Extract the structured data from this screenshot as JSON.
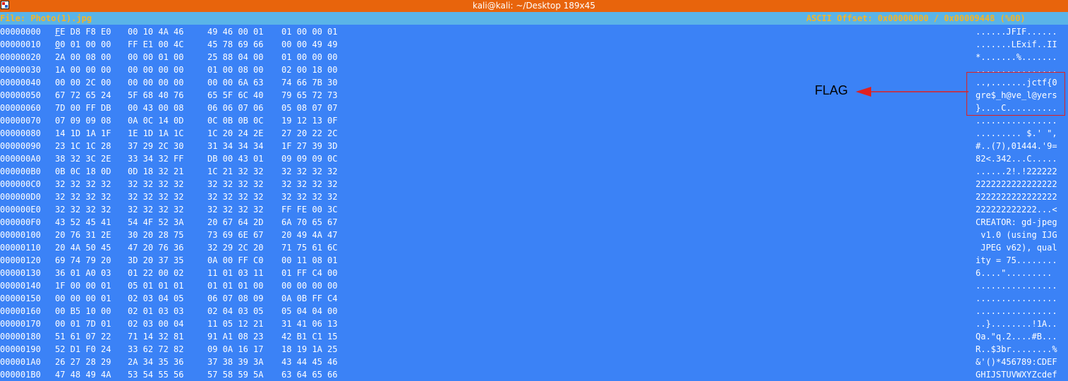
{
  "window": {
    "title": "kali@kali: ~/Desktop 189x45"
  },
  "status": {
    "file": "File: Photo(1).jpg",
    "offset": "ASCII Offset: 0x00000000 / 0x00009448 (%00)"
  },
  "rows": [
    {
      "offset": "00000000",
      "hex": [
        "FE D8 F8 E0",
        "00 10 4A 46",
        "49 46 00 01",
        "01 00 00 01"
      ],
      "ascii": "......JFIF......"
    },
    {
      "offset": "00000010",
      "hex": [
        "00 01 00 00",
        "FF E1 00 4C",
        "45 78 69 66",
        "00 00 49 49"
      ],
      "ascii": ".......LExif..II"
    },
    {
      "offset": "00000020",
      "hex": [
        "2A 00 08 00",
        "00 00 01 00",
        "25 88 04 00",
        "01 00 00 00"
      ],
      "ascii": "*.......%......."
    },
    {
      "offset": "00000030",
      "hex": [
        "1A 00 00 00",
        "00 00 00 00",
        "01 00 08 00",
        "02 00 18 00"
      ],
      "ascii": "................"
    },
    {
      "offset": "00000040",
      "hex": [
        "00 00 2C 00",
        "00 00 00 00",
        "00 00 6A 63",
        "74 66 7B 30"
      ],
      "ascii": "..,.......jctf{0"
    },
    {
      "offset": "00000050",
      "hex": [
        "67 72 65 24",
        "5F 68 40 76",
        "65 5F 6C 40",
        "79 65 72 73"
      ],
      "ascii": "gre$_h@ve_l@yers"
    },
    {
      "offset": "00000060",
      "hex": [
        "7D 00 FF DB",
        "00 43 00 08",
        "06 06 07 06",
        "05 08 07 07"
      ],
      "ascii": "}....C.........."
    },
    {
      "offset": "00000070",
      "hex": [
        "07 09 09 08",
        "0A 0C 14 0D",
        "0C 0B 0B 0C",
        "19 12 13 0F"
      ],
      "ascii": "................"
    },
    {
      "offset": "00000080",
      "hex": [
        "14 1D 1A 1F",
        "1E 1D 1A 1C",
        "1C 20 24 2E",
        "27 20 22 2C"
      ],
      "ascii": "......... $.' \","
    },
    {
      "offset": "00000090",
      "hex": [
        "23 1C 1C 28",
        "37 29 2C 30",
        "31 34 34 34",
        "1F 27 39 3D"
      ],
      "ascii": "#..(7),01444.'9="
    },
    {
      "offset": "000000A0",
      "hex": [
        "38 32 3C 2E",
        "33 34 32 FF",
        "DB 00 43 01",
        "09 09 09 0C"
      ],
      "ascii": "82<.342...C....."
    },
    {
      "offset": "000000B0",
      "hex": [
        "0B 0C 18 0D",
        "0D 18 32 21",
        "1C 21 32 32",
        "32 32 32 32"
      ],
      "ascii": "......2!.!222222"
    },
    {
      "offset": "000000C0",
      "hex": [
        "32 32 32 32",
        "32 32 32 32",
        "32 32 32 32",
        "32 32 32 32"
      ],
      "ascii": "2222222222222222"
    },
    {
      "offset": "000000D0",
      "hex": [
        "32 32 32 32",
        "32 32 32 32",
        "32 32 32 32",
        "32 32 32 32"
      ],
      "ascii": "2222222222222222"
    },
    {
      "offset": "000000E0",
      "hex": [
        "32 32 32 32",
        "32 32 32 32",
        "32 32 32 32",
        "FF FE 00 3C"
      ],
      "ascii": "222222222222...<"
    },
    {
      "offset": "000000F0",
      "hex": [
        "43 52 45 41",
        "54 4F 52 3A",
        "20 67 64 2D",
        "6A 70 65 67"
      ],
      "ascii": "CREATOR: gd-jpeg"
    },
    {
      "offset": "00000100",
      "hex": [
        "20 76 31 2E",
        "30 20 28 75",
        "73 69 6E 67",
        "20 49 4A 47"
      ],
      "ascii": " v1.0 (using IJG"
    },
    {
      "offset": "00000110",
      "hex": [
        "20 4A 50 45",
        "47 20 76 36",
        "32 29 2C 20",
        "71 75 61 6C"
      ],
      "ascii": " JPEG v62), qual"
    },
    {
      "offset": "00000120",
      "hex": [
        "69 74 79 20",
        "3D 20 37 35",
        "0A 00 FF C0",
        "00 11 08 01"
      ],
      "ascii": "ity = 75........"
    },
    {
      "offset": "00000130",
      "hex": [
        "36 01 A0 03",
        "01 22 00 02",
        "11 01 03 11",
        "01 FF C4 00"
      ],
      "ascii": "6....\"........."
    },
    {
      "offset": "00000140",
      "hex": [
        "1F 00 00 01",
        "05 01 01 01",
        "01 01 01 00",
        "00 00 00 00"
      ],
      "ascii": "................"
    },
    {
      "offset": "00000150",
      "hex": [
        "00 00 00 01",
        "02 03 04 05",
        "06 07 08 09",
        "0A 0B FF C4"
      ],
      "ascii": "................"
    },
    {
      "offset": "00000160",
      "hex": [
        "00 B5 10 00",
        "02 01 03 03",
        "02 04 03 05",
        "05 04 04 00"
      ],
      "ascii": "................"
    },
    {
      "offset": "00000170",
      "hex": [
        "00 01 7D 01",
        "02 03 00 04",
        "11 05 12 21",
        "31 41 06 13"
      ],
      "ascii": "..}........!1A.."
    },
    {
      "offset": "00000180",
      "hex": [
        "51 61 07 22",
        "71 14 32 81",
        "91 A1 08 23",
        "42 B1 C1 15"
      ],
      "ascii": "Qa.\"q.2....#B..."
    },
    {
      "offset": "00000190",
      "hex": [
        "52 D1 F0 24",
        "33 62 72 82",
        "09 0A 16 17",
        "18 19 1A 25"
      ],
      "ascii": "R..$3br........%"
    },
    {
      "offset": "000001A0",
      "hex": [
        "26 27 28 29",
        "2A 34 35 36",
        "37 38 39 3A",
        "43 44 45 46"
      ],
      "ascii": "&'()*456789:CDEF"
    },
    {
      "offset": "000001B0",
      "hex": [
        "47 48 49 4A",
        "53 54 55 56",
        "57 58 59 5A",
        "63 64 65 66"
      ],
      "ascii": "GHIJSTUVWXYZcdef"
    }
  ],
  "annotation": {
    "label": "FLAG",
    "color": "#e02020"
  },
  "colors": {
    "background": "#3b82f6",
    "titlebar": "#e8640c",
    "statusbar": "#5ab4e8",
    "status_text": "#f3b428"
  }
}
